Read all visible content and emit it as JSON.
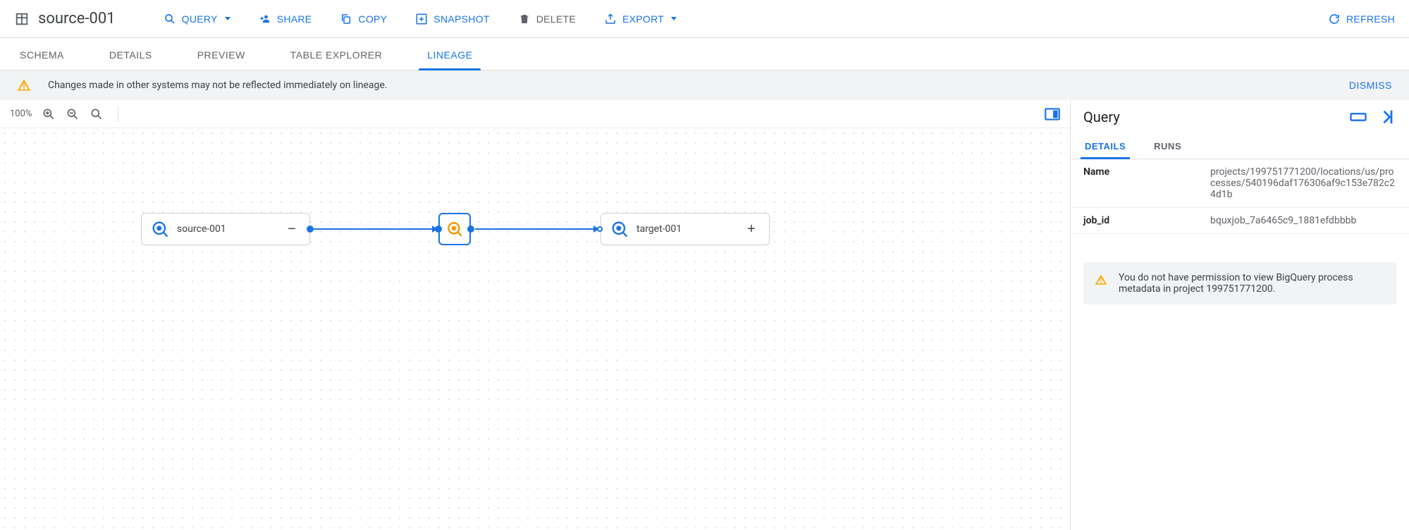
{
  "header": {
    "title": "source-001",
    "actions": {
      "query": "QUERY",
      "share": "SHARE",
      "copy": "COPY",
      "snapshot": "SNAPSHOT",
      "delete": "DELETE",
      "export": "EXPORT",
      "refresh": "REFRESH"
    }
  },
  "tabs": {
    "schema": "SCHEMA",
    "details": "DETAILS",
    "preview": "PREVIEW",
    "table_explorer": "TABLE EXPLORER",
    "lineage": "LINEAGE"
  },
  "banner": {
    "message": "Changes made in other systems may not be reflected immediately on lineage.",
    "dismiss": "DISMISS"
  },
  "zoom": {
    "level": "100%"
  },
  "lineage": {
    "source_label": "source-001",
    "target_label": "target-001"
  },
  "side_panel": {
    "title": "Query",
    "tabs": {
      "details": "DETAILS",
      "runs": "RUNS"
    },
    "rows": {
      "name_key": "Name",
      "name_val": "projects/199751771200/locations/us/processes/540196daf176306af9c153e782c24d1b",
      "jobid_key": "job_id",
      "jobid_val": "bquxjob_7a6465c9_1881efdbbbb"
    },
    "warning": "You do not have permission to view BigQuery process metadata in project 199751771200."
  }
}
